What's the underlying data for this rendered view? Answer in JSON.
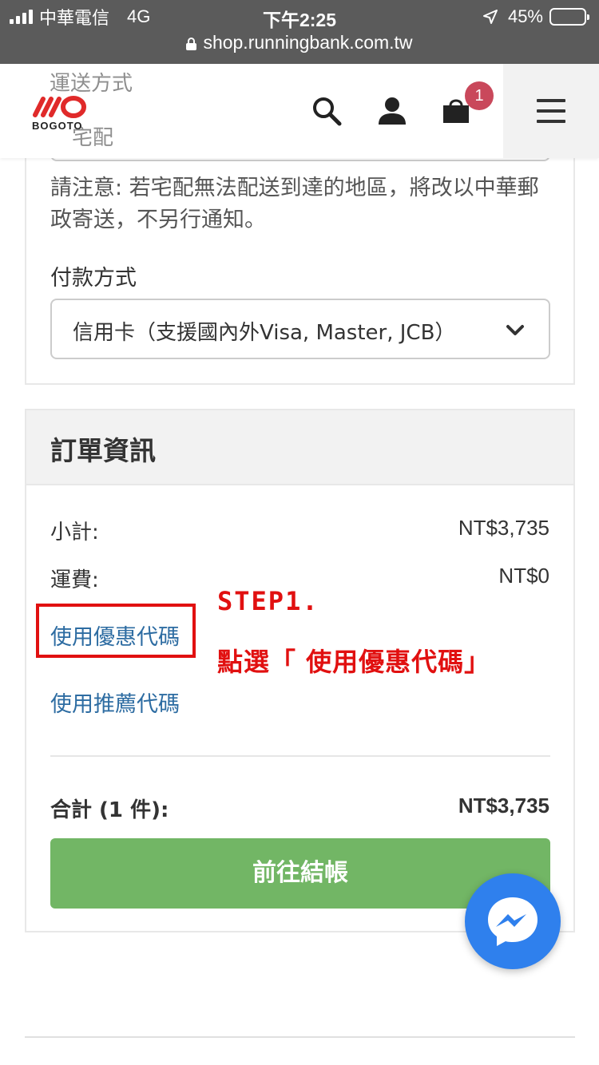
{
  "status_bar": {
    "carrier": "中華電信",
    "network": "4G",
    "time": "下午2:25",
    "battery": "45%",
    "battery_level": 0.45,
    "url": "shop.runningbank.com.tw"
  },
  "header": {
    "logo_text": "BOGOTO",
    "cart_count": "1",
    "brand_color": "#e02a2a"
  },
  "shipping": {
    "label_hidden": "運送方式",
    "selected_hidden": "宅配",
    "notice": "請注意: 若宅配無法配送到達的地區，將改以中華郵政寄送，不另行通知。"
  },
  "payment": {
    "label": "付款方式",
    "selected": "信用卡（支援國內外Visa, Master, JCB）"
  },
  "order": {
    "title": "訂單資訊",
    "subtotal_label": "小計:",
    "subtotal_value": "NT$3,735",
    "shipping_fee_label": "運費:",
    "shipping_fee_value": "NT$0",
    "coupon_link": "使用優惠代碼",
    "referral_link": "使用推薦代碼",
    "total_label": "合計 (1 件):",
    "total_value": "NT$3,735",
    "checkout_button": "前往結帳"
  },
  "annotation": {
    "step": "STEP1.",
    "instruction": "點選「 使用優惠代碼」",
    "color": "#e11010"
  },
  "colors": {
    "checkout_green": "#72b665",
    "link_blue": "#2d6ca2",
    "messenger_blue": "#2f80ed",
    "badge_red": "#c9485b"
  }
}
